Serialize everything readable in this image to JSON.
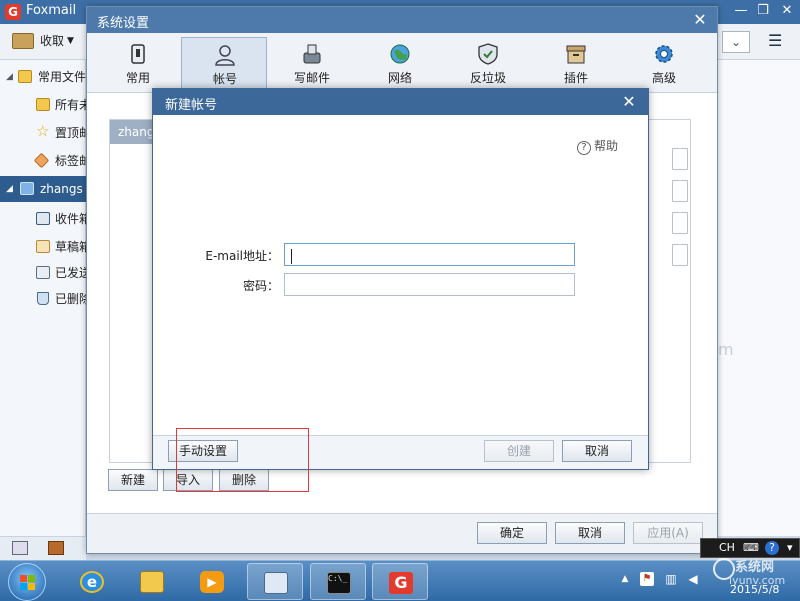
{
  "foxmail": {
    "title": "Foxmail",
    "toolbar": {
      "receive_label": "收取"
    },
    "sidebar": {
      "common_folders": "常用文件",
      "all_unread": "所有未",
      "starred": "置顶邮",
      "tags": "标签邮",
      "account": "zhangs",
      "inbox": "收件箱",
      "drafts": "草稿箱",
      "sent": "已发送",
      "deleted": "已删除"
    }
  },
  "settings": {
    "title": "系统设置",
    "tabs": [
      {
        "label": "常用",
        "icon": "general-icon"
      },
      {
        "label": "帐号",
        "icon": "account-icon"
      },
      {
        "label": "写邮件",
        "icon": "compose-icon"
      },
      {
        "label": "网络",
        "icon": "network-icon"
      },
      {
        "label": "反垃圾",
        "icon": "antispam-icon"
      },
      {
        "label": "插件",
        "icon": "plugin-icon"
      },
      {
        "label": "高级",
        "icon": "advanced-icon"
      }
    ],
    "active_tab": "帐号",
    "account_list": [
      "zhang"
    ],
    "buttons": {
      "new": "新建",
      "import": "导入",
      "delete": "删除"
    },
    "footer": {
      "ok": "确定",
      "cancel": "取消",
      "apply": "应用(A)"
    }
  },
  "new_account": {
    "title": "新建帐号",
    "help": "帮助",
    "email_label": "E-mail地址：",
    "email_value": "",
    "password_label": "密码：",
    "password_value": "",
    "manual_setup": "手动设置",
    "create": "创建",
    "cancel": "取消"
  },
  "taskbar": {
    "language": "CH",
    "clock_date": "2015/5/8"
  },
  "watermark": {
    "cn": "系统网",
    "en": "iyunv.com"
  },
  "colors": {
    "titlebar": "#3d6fa6",
    "dialog_titlebar": "#3b6898",
    "highlight_box": "#e0393b",
    "taskbar": "#2f6aa6"
  }
}
